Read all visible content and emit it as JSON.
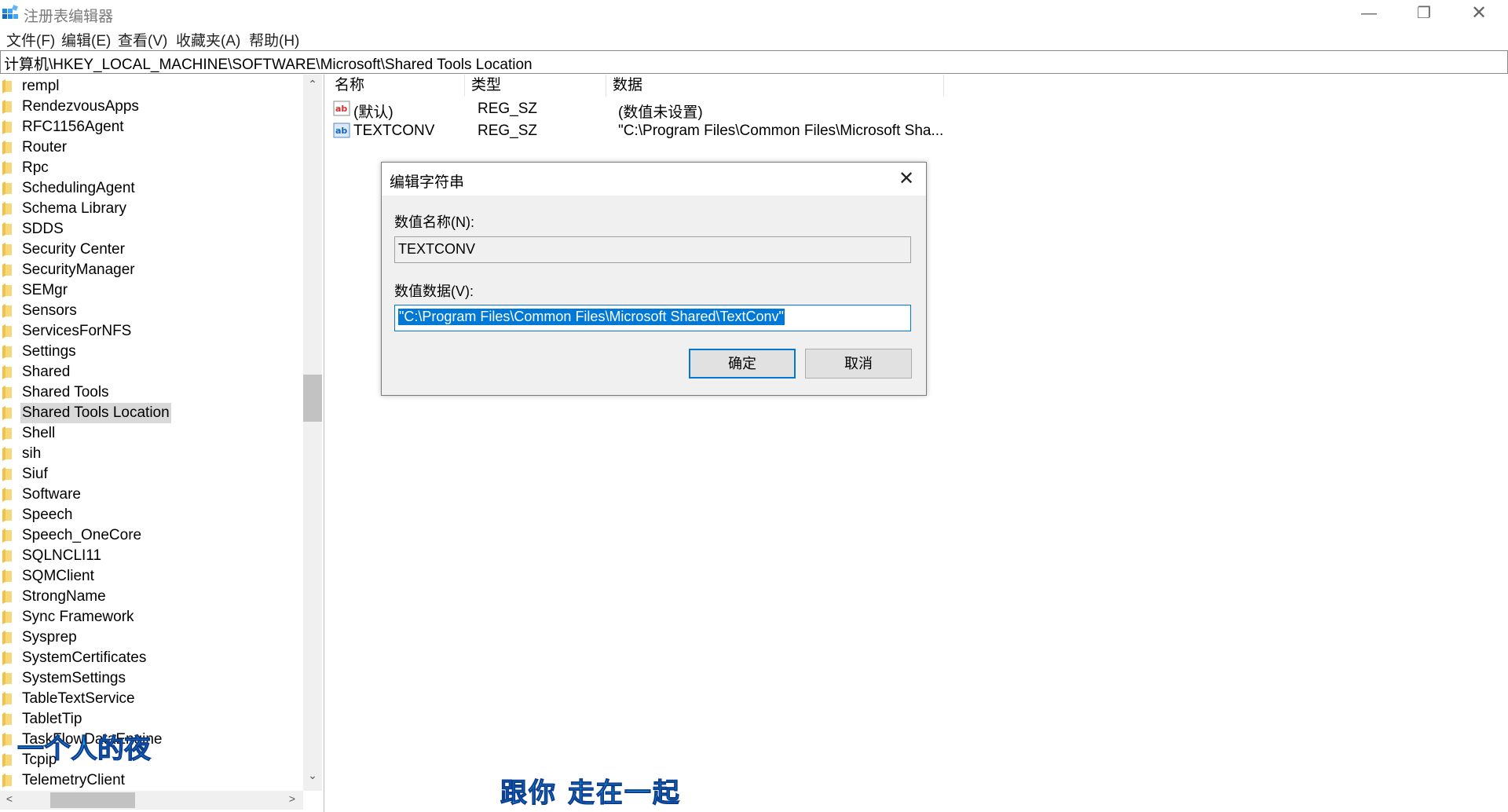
{
  "window": {
    "title": "注册表编辑器",
    "minimize": "—",
    "maximize": "❐",
    "close": "✕"
  },
  "menu": [
    "文件(F)",
    "编辑(E)",
    "查看(V)",
    "收藏夹(A)",
    "帮助(H)"
  ],
  "address": "计算机\\HKEY_LOCAL_MACHINE\\SOFTWARE\\Microsoft\\Shared Tools Location",
  "tree": {
    "items": [
      "rempl",
      "RendezvousApps",
      "RFC1156Agent",
      "Router",
      "Rpc",
      "SchedulingAgent",
      "Schema Library",
      "SDDS",
      "Security Center",
      "SecurityManager",
      "SEMgr",
      "Sensors",
      "ServicesForNFS",
      "Settings",
      "Shared",
      "Shared Tools",
      "Shared Tools Location",
      "Shell",
      "sih",
      "Siuf",
      "Software",
      "Speech",
      "Speech_OneCore",
      "SQLNCLI11",
      "SQMClient",
      "StrongName",
      "Sync Framework",
      "Sysprep",
      "SystemCertificates",
      "SystemSettings",
      "TableTextService",
      "TabletTip",
      "TaskFlowDataEngine",
      "Tcpip",
      "TelemetryClient"
    ],
    "selected_index": 16,
    "scroll_up": "⌃",
    "scroll_down": "⌄",
    "scroll_left": "<",
    "scroll_right": ">"
  },
  "list": {
    "columns": [
      "名称",
      "类型",
      "数据"
    ],
    "rows": [
      {
        "name": "(默认)",
        "type": "REG_SZ",
        "data": "(数值未设置)",
        "icon": "string-value-icon"
      },
      {
        "name": "TEXTCONV",
        "type": "REG_SZ",
        "data": "\"C:\\Program Files\\Common Files\\Microsoft Sha...",
        "icon": "string-value-icon"
      }
    ]
  },
  "dialog": {
    "title": "编辑字符串",
    "close": "✕",
    "name_label": "数值名称(N):",
    "name_value": "TEXTCONV",
    "data_label": "数值数据(V):",
    "data_value": "\"C:\\Program Files\\Common Files\\Microsoft Shared\\TextConv\"",
    "ok": "确定",
    "cancel": "取消"
  },
  "overlays": {
    "left": "一个人的夜",
    "bottom": "跟你 走在一起"
  },
  "colors": {
    "accent": "#0078d7",
    "folder": "#f1c24a",
    "overlay_text": "#2aa7e0"
  }
}
